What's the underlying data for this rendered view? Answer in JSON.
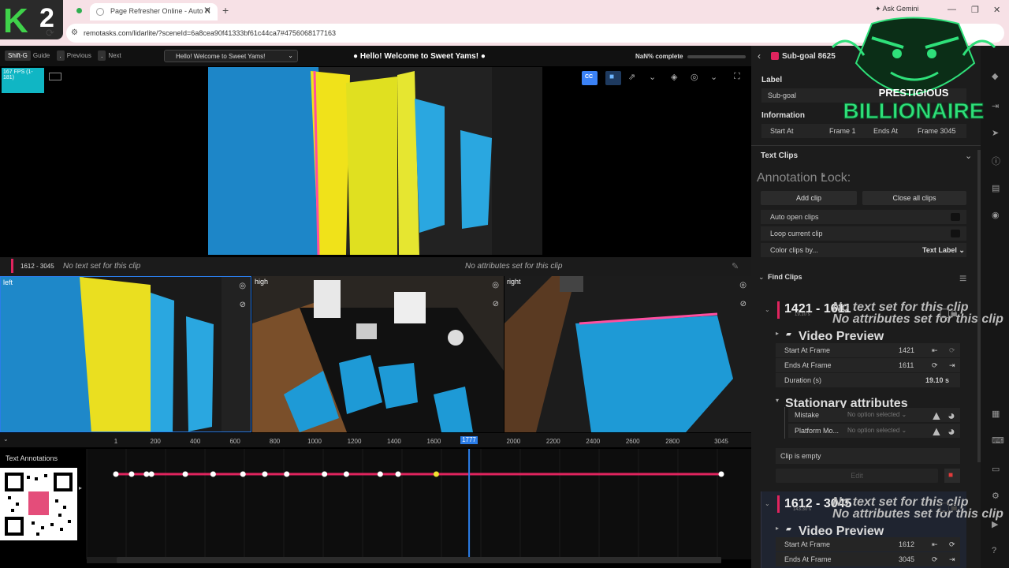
{
  "browser": {
    "tab_title": "Page Refresher Online - Auto R",
    "url": "remotasks.com/lidarlite/?sceneId=6a8cea90f41333bf61c44ca7#4756068177163",
    "ask_gemini": "Ask Gemini",
    "badge": "2"
  },
  "header": {
    "shortcut_key": "Shift-G",
    "guide": "Guide",
    "previous": "Previous",
    "next": "Next",
    "welcome_button": "Hello! Welcome to Sweet Yams!",
    "welcome_title": "Hello! Welcome to Sweet Yams!",
    "progress_text": "NaN% complete",
    "progress_fraction": 0,
    "fps": "167 FPS (1-181)",
    "cc_label": "CC"
  },
  "clip_strip": {
    "range": "1612 - 3045",
    "text": "No text set for this clip",
    "attributes": "No attributes set for this clip"
  },
  "cameras": {
    "left": "left",
    "high": "high",
    "right": "right"
  },
  "timeline": {
    "ticks": [
      "1",
      "200",
      "400",
      "600",
      "800",
      "1000",
      "1200",
      "1400",
      "1600",
      "1777",
      "2000",
      "2200",
      "2400",
      "2600",
      "2800",
      "3045"
    ],
    "current_frame": "1777",
    "label": "Text Annotations",
    "keyframes": [
      1,
      80,
      155,
      180,
      350,
      490,
      640,
      750,
      860,
      1050,
      1160,
      1330,
      1420,
      1612,
      3045
    ],
    "highlight_keyframe": 1612,
    "frame_min": 1,
    "frame_max": 3045,
    "playhead": 1777
  },
  "panel": {
    "title": "Sub-goal 8625",
    "label_heading": "Label",
    "label_value": "Sub-goal",
    "info_heading": "Information",
    "start_at": "Start At",
    "frame1": "Frame 1",
    "ends_at": "Ends At",
    "frame3045": "Frame 3045",
    "text_clips": "Text Clips",
    "annotation_lock": "Annotation Lock:",
    "add_clip": "Add clip",
    "close_all_clips": "Close all clips",
    "auto_open_clips": "Auto open clips",
    "loop_current_clip": "Loop current clip",
    "color_clips_by": "Color clips by...",
    "color_clips_value": "Text Label",
    "find_clips": "Find Clips",
    "clip1": {
      "range": "1421 - 1611",
      "duration_small": "19.10 s",
      "text": "No text set for this clip",
      "attributes": "No attributes set for this clip",
      "video_preview": "Video Preview",
      "start_at_frame": "Start At Frame",
      "start_value": "1421",
      "ends_at_frame": "Ends At Frame",
      "end_value": "1611",
      "duration": "Duration (s)",
      "duration_value": "19.10 s",
      "stationary": "Stationary attributes",
      "mistake": "Mistake",
      "platform": "Platform Mo...",
      "no_option": "No option selected",
      "clip_empty": "Clip is empty",
      "edit": "Edit"
    },
    "clip2": {
      "range": "1612 - 3045",
      "duration_small": "143.30 s",
      "text": "No text set for this clip",
      "attributes": "No attributes set for this clip",
      "video_preview": "Video Preview",
      "start_at_frame": "Start At Frame",
      "start_value": "1612",
      "ends_at_frame": "Ends At Frame",
      "end_value": "3045"
    }
  },
  "logo": {
    "line1": "PRESTIGIOUS",
    "line2": "BILLIONAIRE"
  },
  "colors": {
    "accent_pink": "#e0245e",
    "accent_blue": "#2b7de9",
    "fps_cyan": "#10b6c4",
    "logo_green": "#2fe07a"
  }
}
